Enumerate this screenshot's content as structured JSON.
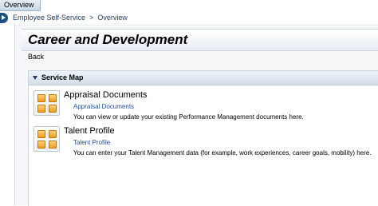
{
  "tabs": [
    {
      "label": "Overview"
    }
  ],
  "breadcrumb": {
    "items": [
      "Employee Self-Service",
      "Overview"
    ]
  },
  "page": {
    "title": "Career and Development",
    "back_label": "Back"
  },
  "service_map": {
    "title": "Service Map",
    "services": [
      {
        "title": "Appraisal Documents",
        "link": "Appraisal Documents",
        "description": "You can view or update your existing Performance Management documents here."
      },
      {
        "title": "Talent Profile",
        "link": "Talent Profile",
        "description": "You can enter your Talent Management data (for example, work experiences, career goals, mobility) here."
      }
    ]
  },
  "colors": {
    "accent": "#1c4f86",
    "link": "#1d4d9e",
    "icon_fill": "#f09a1e"
  },
  "icons": {
    "nav": "arrow-right-icon",
    "collapse": "triangle-down-icon",
    "service": "service-grid-icon"
  }
}
